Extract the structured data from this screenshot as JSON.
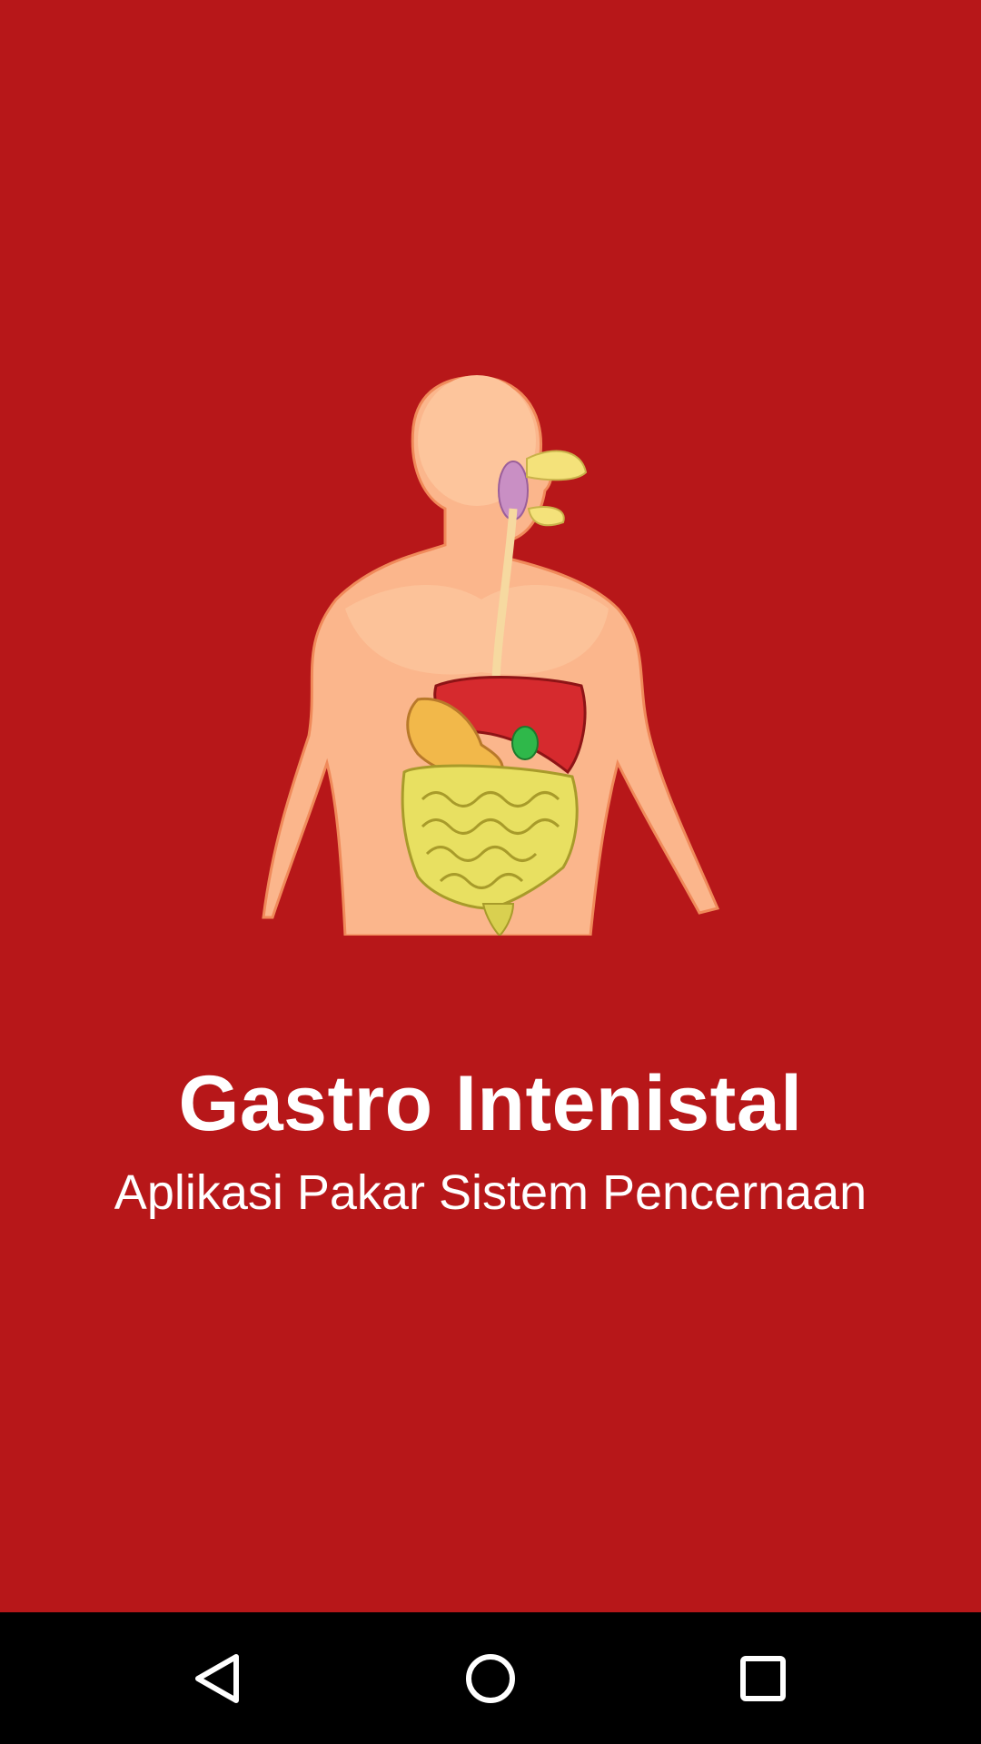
{
  "splash": {
    "background_color": "#b71719",
    "illustration_icon": "digestive-system-illustration",
    "title": "Gastro Intenistal",
    "subtitle": "Aplikasi Pakar Sistem Pencernaan"
  },
  "navigation_bar": {
    "background_color": "#000000",
    "buttons": [
      {
        "icon": "back-triangle-icon"
      },
      {
        "icon": "home-circle-icon"
      },
      {
        "icon": "recents-square-icon"
      }
    ]
  }
}
